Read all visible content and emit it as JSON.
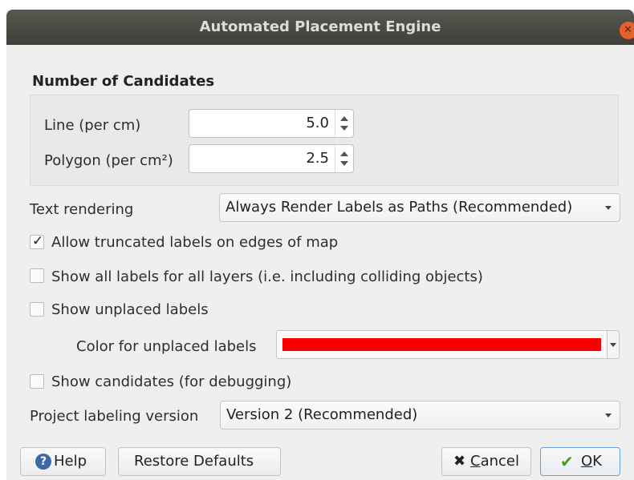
{
  "window": {
    "title": "Automated Placement Engine"
  },
  "candidates": {
    "title": "Number of Candidates",
    "line_label": "Line (per cm)",
    "line_value": "5.0",
    "polygon_label": "Polygon (per cm²)",
    "polygon_value": "2.5"
  },
  "text_rendering": {
    "label": "Text rendering",
    "value": "Always Render Labels as Paths (Recommended)"
  },
  "options": {
    "truncated": {
      "label": "Allow truncated labels on edges of map",
      "checked": true
    },
    "show_all": {
      "label": "Show all labels for all layers (i.e. including colliding objects)",
      "checked": false
    },
    "unplaced": {
      "label": "Show unplaced labels",
      "checked": false
    },
    "candidates": {
      "label": "Show candidates (for debugging)",
      "checked": false
    }
  },
  "unplaced_color": {
    "label": "Color for unplaced labels",
    "color": "#f90000"
  },
  "labeling_version": {
    "label": "Project labeling version",
    "value": "Version 2 (Recommended)"
  },
  "buttons": {
    "help": "Help",
    "restore": "Restore Defaults",
    "cancel_prefix": "",
    "cancel_key": "C",
    "cancel_rest": "ancel",
    "ok_key": "O",
    "ok_rest": "K"
  }
}
